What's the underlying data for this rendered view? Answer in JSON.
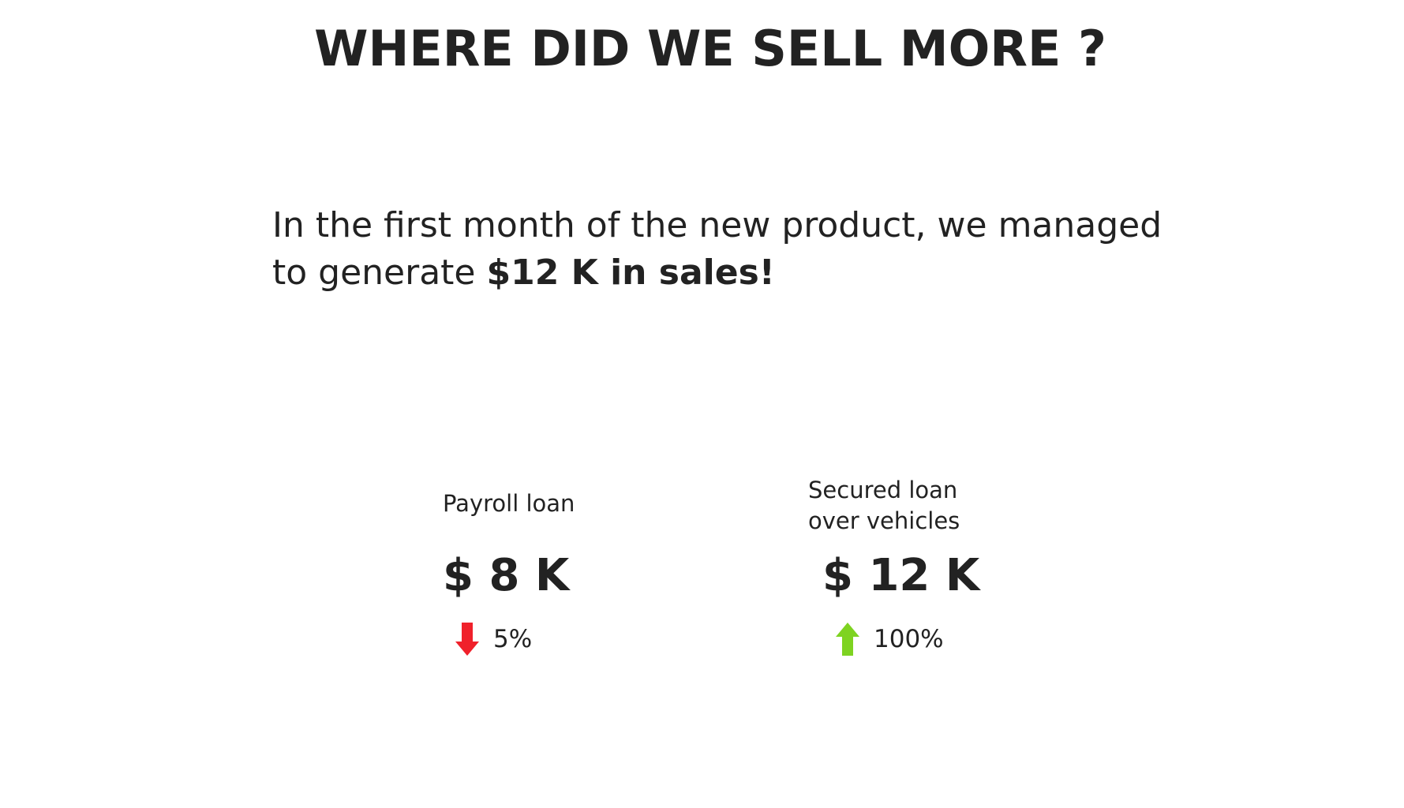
{
  "title": "WHERE DID WE SELL MORE ?",
  "intro": {
    "line1": "In the first month of the new product, we managed",
    "line2_plain": "to generate ",
    "line2_bold": "$12 K in sales!"
  },
  "kpis": [
    {
      "label_lines": [
        "Payroll loan"
      ],
      "value": "$ 8 K",
      "change": "5%",
      "direction": "down",
      "arrow_icon": "arrow-down-icon",
      "arrow_color": "#f0212b"
    },
    {
      "label_lines": [
        "Secured loan",
        "over vehicles"
      ],
      "value": "$ 12 K",
      "change": "100%",
      "direction": "up",
      "arrow_icon": "arrow-up-icon",
      "arrow_color": "#7ed321"
    }
  ]
}
